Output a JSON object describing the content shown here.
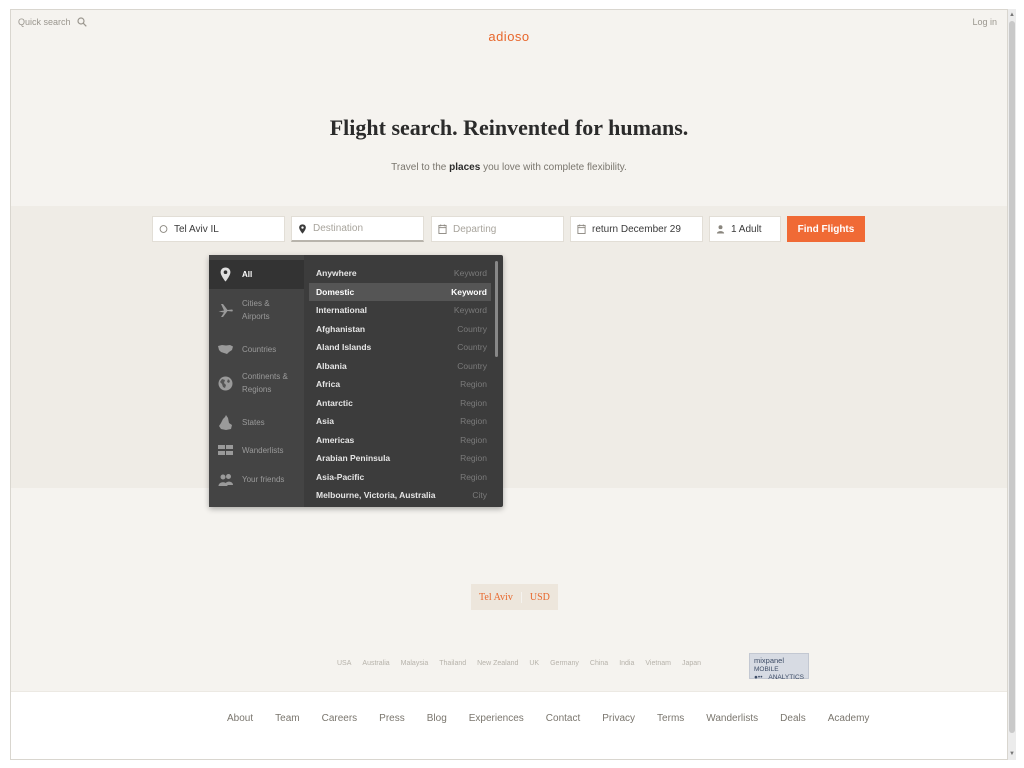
{
  "topbar": {
    "quick_search": "Quick search",
    "logo": "adioso",
    "login": "Log in"
  },
  "hero": {
    "title": "Flight search. Reinvented for humans.",
    "subtitle_pre": "Travel to the ",
    "subtitle_bold": "places",
    "subtitle_post": " you love with complete flexibility."
  },
  "search": {
    "origin": "Tel Aviv IL",
    "destination_placeholder": "Destination",
    "departing_placeholder": "Departing",
    "return_value": "return December 29",
    "travelers": "1 Adult",
    "find_button": "Find Flights"
  },
  "dropdown": {
    "categories": [
      {
        "label": "All",
        "icon": "pin-icon"
      },
      {
        "label": "Cities & Airports",
        "icon": "plane-icon"
      },
      {
        "label": "Countries",
        "icon": "country-map-icon"
      },
      {
        "label": "Continents & Regions",
        "icon": "globe-icon"
      },
      {
        "label": "States",
        "icon": "state-map-icon"
      },
      {
        "label": "Wanderlists",
        "icon": "wanderlist-icon"
      },
      {
        "label": "Your friends",
        "icon": "friends-icon"
      }
    ],
    "active_category": "All",
    "results": [
      {
        "name": "Anywhere",
        "kind": "Keyword"
      },
      {
        "name": "Domestic",
        "kind": "Keyword"
      },
      {
        "name": "International",
        "kind": "Keyword"
      },
      {
        "name": "Afghanistan",
        "kind": "Country"
      },
      {
        "name": "Aland Islands",
        "kind": "Country"
      },
      {
        "name": "Albania",
        "kind": "Country"
      },
      {
        "name": "Africa",
        "kind": "Region"
      },
      {
        "name": "Antarctic",
        "kind": "Region"
      },
      {
        "name": "Asia",
        "kind": "Region"
      },
      {
        "name": "Americas",
        "kind": "Region"
      },
      {
        "name": "Arabian Peninsula",
        "kind": "Region"
      },
      {
        "name": "Asia-Pacific",
        "kind": "Region"
      },
      {
        "name": "Melbourne, Victoria, Australia",
        "kind": "City"
      }
    ],
    "highlighted_result": "Domestic"
  },
  "locale": {
    "city": "Tel Aviv",
    "currency": "USD"
  },
  "countries": [
    "USA",
    "Australia",
    "Malaysia",
    "Thailand",
    "New Zealand",
    "UK",
    "Germany",
    "China",
    "India",
    "Vietnam",
    "Japan"
  ],
  "mixpanel": {
    "line1": "mixpanel",
    "line1b": "MOBILE",
    "line2": "ANALYTICS"
  },
  "footer": {
    "links": [
      "About",
      "Team",
      "Careers",
      "Press",
      "Blog",
      "Experiences",
      "Contact",
      "Privacy",
      "Terms",
      "Wanderlists",
      "Deals",
      "Academy"
    ]
  },
  "colors": {
    "accent": "#f06a35",
    "logo": "#e8672c",
    "background": "#f5f3ef",
    "dropdown_bg": "#3c3c3c"
  }
}
